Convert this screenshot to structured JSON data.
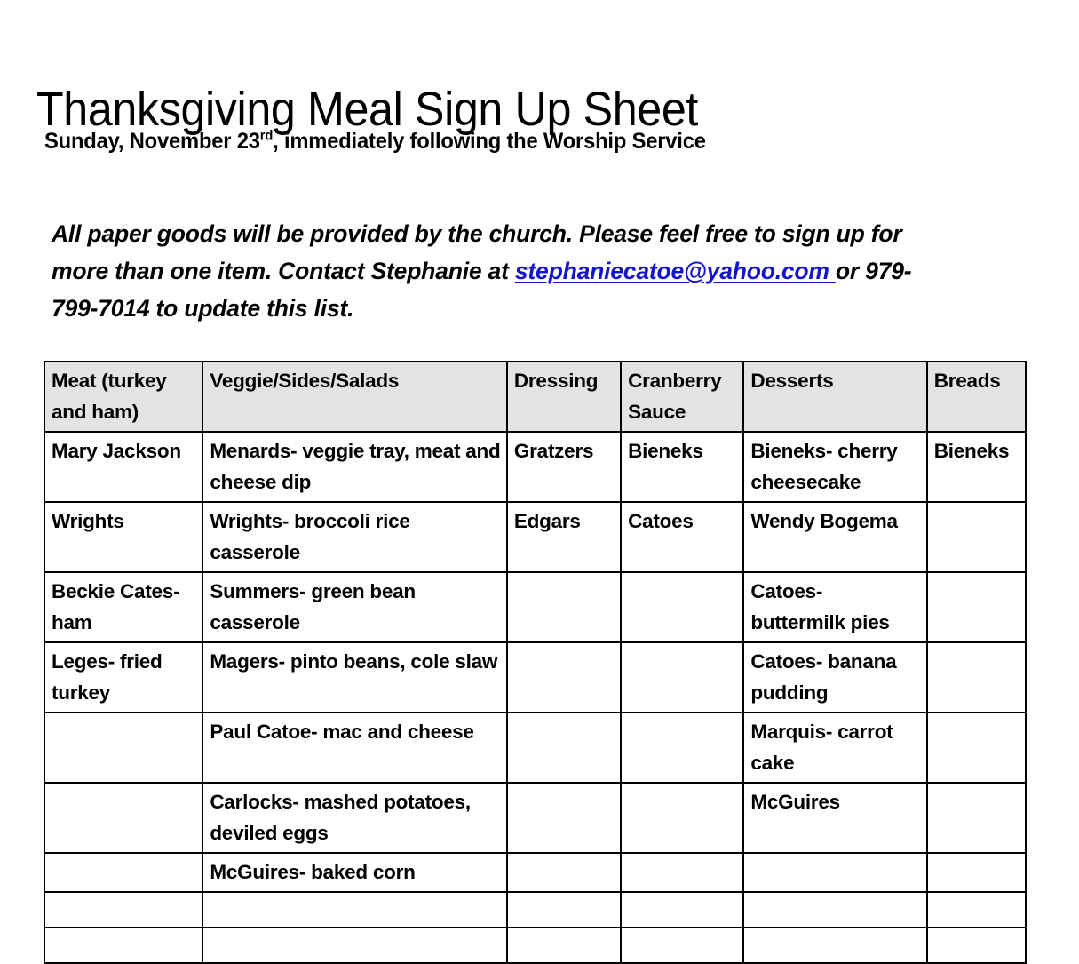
{
  "document": {
    "title": "Thanksgiving Meal Sign Up Sheet",
    "subtitle_prefix": "Sunday, November 23",
    "subtitle_superscript": "rd",
    "subtitle_suffix": ", immediately following the Worship Service",
    "intro_before_link": "All paper goods will be provided by the church. Please feel free to sign up for more than one item. Contact Stephanie at ",
    "email_link_text": "stephaniecatoe@yahoo.com ",
    "intro_after_link": "or 979-799-7014 to update this list.",
    "link_color": "#1414cf",
    "header_background": "#e3e3e3",
    "border_color": "#000000"
  },
  "table": {
    "columns": [
      "Meat (turkey and ham)",
      "Veggie/Sides/Salads",
      "Dressing",
      "Cranberry Sauce",
      "Desserts",
      "Breads"
    ],
    "rows": [
      {
        "meat": "Mary Jackson",
        "veggie": "Menards- veggie tray, meat and cheese dip",
        "dressing": "Gratzers",
        "cranberry": "Bieneks",
        "desserts": "Bieneks- cherry cheesecake",
        "breads": "Bieneks"
      },
      {
        "meat": "Wrights",
        "veggie": "Wrights- broccoli rice casserole",
        "dressing": "Edgars",
        "cranberry": "Catoes",
        "desserts": "Wendy Bogema",
        "breads": ""
      },
      {
        "meat": "Beckie Cates- ham",
        "veggie": "Summers- green bean casserole",
        "dressing": "",
        "cranberry": "",
        "desserts": "Catoes- buttermilk pies",
        "breads": ""
      },
      {
        "meat": "Leges- fried turkey",
        "veggie": "Magers- pinto beans, cole slaw",
        "dressing": "",
        "cranberry": "",
        "desserts": "Catoes- banana pudding",
        "breads": ""
      },
      {
        "meat": "",
        "veggie": "Paul Catoe- mac and cheese",
        "dressing": "",
        "cranberry": "",
        "desserts": "Marquis- carrot cake",
        "breads": ""
      },
      {
        "meat": "",
        "veggie": "Carlocks- mashed potatoes, deviled eggs",
        "dressing": "",
        "cranberry": "",
        "desserts": "McGuires",
        "breads": ""
      },
      {
        "meat": "",
        "veggie": "McGuires- baked corn",
        "dressing": "",
        "cranberry": "",
        "desserts": "",
        "breads": ""
      },
      {
        "meat": "",
        "veggie": "",
        "dressing": "",
        "cranberry": "",
        "desserts": "",
        "breads": ""
      },
      {
        "meat": "",
        "veggie": "",
        "dressing": "",
        "cranberry": "",
        "desserts": "",
        "breads": ""
      }
    ]
  }
}
